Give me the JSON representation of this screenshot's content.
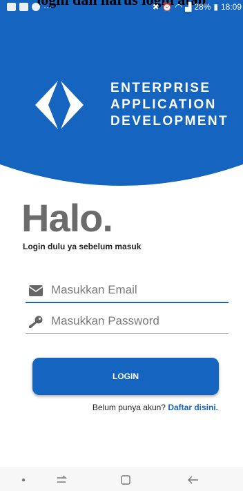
{
  "caption": "login dan harus login atau",
  "status_bar": {
    "battery": "28%",
    "time": "18:09",
    "dots": "···"
  },
  "brand": {
    "line1": "ENTERPRISE",
    "line2": "APPLICATION",
    "line3": "DEVELOPMENT"
  },
  "greeting": {
    "title": "Halo.",
    "subtitle": "Login dulu ya sebelum masuk"
  },
  "form": {
    "email_placeholder": "Masukkan Email",
    "password_placeholder": "Masukkan Password",
    "email_icon": "envelope-icon",
    "password_icon": "key-icon"
  },
  "login_button": "LOGIN",
  "register": {
    "prompt": "Belum punya akun?",
    "link": "Daftar disini."
  },
  "colors": {
    "primary": "#1565c0",
    "title_gray": "#6b6b6b"
  },
  "navbar": {
    "icons": [
      "dot-icon",
      "recent-apps-icon",
      "home-icon",
      "back-icon"
    ]
  }
}
